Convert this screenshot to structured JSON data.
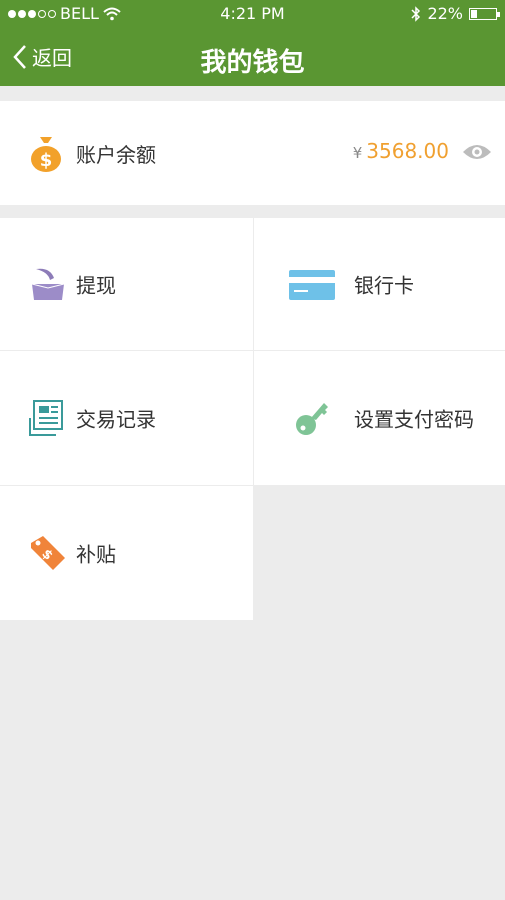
{
  "status_bar": {
    "carrier": "BELL",
    "time": "4:21 PM",
    "battery": "22%"
  },
  "nav": {
    "back_label": "返回",
    "title": "我的钱包"
  },
  "balance": {
    "label": "账户余额",
    "currency": "¥",
    "amount": "3568.00"
  },
  "menu": [
    {
      "label": "提现",
      "icon": "withdraw-tray-icon"
    },
    {
      "label": "银行卡",
      "icon": "bank-card-icon"
    },
    {
      "label": "交易记录",
      "icon": "transaction-record-icon"
    },
    {
      "label": "设置支付密码",
      "icon": "key-icon"
    },
    {
      "label": "补贴",
      "icon": "subsidy-tag-icon"
    }
  ],
  "colors": {
    "header": "#5a9632",
    "amount": "#f0a030",
    "background": "#ececec"
  }
}
